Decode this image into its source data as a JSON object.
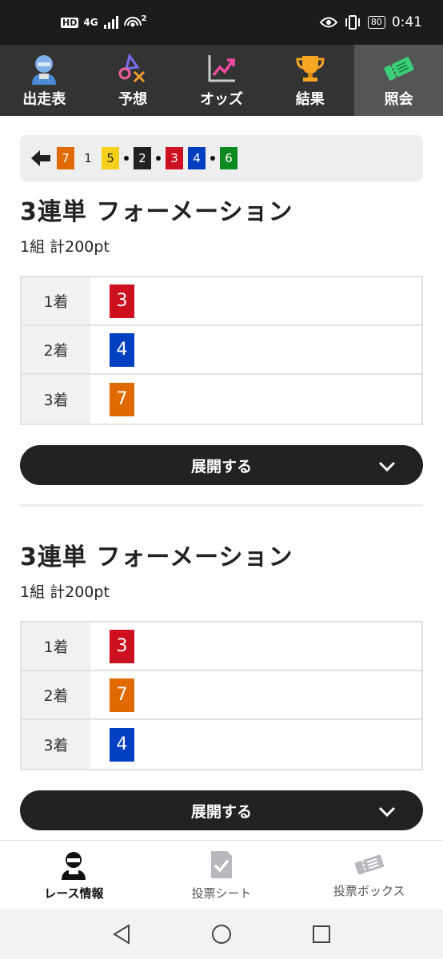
{
  "status_bar": {
    "hd": "HD",
    "network": "4G",
    "superscript": "2",
    "battery": "80",
    "time": "0:41"
  },
  "top_nav": [
    {
      "label": "出走表",
      "icon": "jockey-icon"
    },
    {
      "label": "予想",
      "icon": "shapes-icon"
    },
    {
      "label": "オッズ",
      "icon": "trend-chart-icon"
    },
    {
      "label": "結果",
      "icon": "trophy-icon"
    },
    {
      "label": "照会",
      "icon": "ticket-icon"
    }
  ],
  "summary": {
    "chips": [
      {
        "num": "7",
        "bg": "#e06a00",
        "fg": "#ffffff"
      },
      {
        "num": "1",
        "bg": "#eeeeee",
        "fg": "#222222"
      },
      {
        "num": "5",
        "bg": "#f5d01a",
        "fg": "#222222"
      },
      {
        "num": "2",
        "bg": "#222222",
        "fg": "#ffffff"
      },
      {
        "num": "3",
        "bg": "#cc1020",
        "fg": "#ffffff"
      },
      {
        "num": "4",
        "bg": "#0040c0",
        "fg": "#ffffff"
      },
      {
        "num": "6",
        "bg": "#0a8a20",
        "fg": "#ffffff"
      }
    ]
  },
  "sections": [
    {
      "title": "3連単 フォーメーション",
      "subtitle": "1組 計200pt",
      "rows": [
        {
          "label": "1着",
          "num": "3",
          "color": "#cc1020"
        },
        {
          "label": "2着",
          "num": "4",
          "color": "#0040c0"
        },
        {
          "label": "3着",
          "num": "7",
          "color": "#e06a00"
        }
      ],
      "expand_label": "展開する"
    },
    {
      "title": "3連単 フォーメーション",
      "subtitle": "1組 計200pt",
      "rows": [
        {
          "label": "1着",
          "num": "3",
          "color": "#cc1020"
        },
        {
          "label": "2着",
          "num": "7",
          "color": "#e06a00"
        },
        {
          "label": "3着",
          "num": "4",
          "color": "#0040c0"
        }
      ],
      "expand_label": "展開する"
    }
  ],
  "bottom_tabs": [
    {
      "label": "レース情報",
      "icon": "jockey-icon"
    },
    {
      "label": "投票シート",
      "icon": "check-sheet-icon"
    },
    {
      "label": "投票ボックス",
      "icon": "ticket-icon"
    }
  ]
}
